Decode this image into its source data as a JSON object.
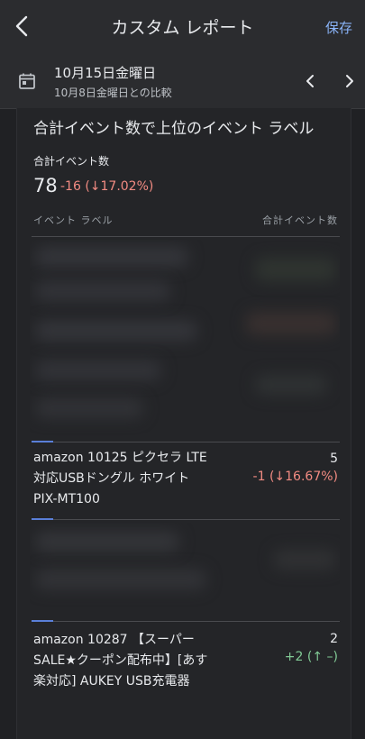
{
  "header": {
    "title": "カスタム レポート",
    "save_label": "保存"
  },
  "date": {
    "main": "10月15日金曜日",
    "comparison": "10月8日金曜日との比較"
  },
  "card": {
    "title": "合計イベント数で上位のイベント ラベル",
    "metric_label": "合計イベント数",
    "metric_value": "78",
    "metric_change": "-16 (↓17.02%)",
    "column_left": "イベント ラベル",
    "column_right": "合計イベント数"
  },
  "rows": [
    {
      "name": "amazon 10125 ピクセラ LTE対応USBドングル ホワイト PIX-MT100",
      "count": "5",
      "change": "-1 (↓16.67%)"
    },
    {
      "name": "amazon 10287 【スーパーSALE★クーポン配布中】[あす楽対応] AUKEY USB充電器",
      "count": "2",
      "change": "+2 (↑ –)"
    }
  ],
  "colors": {
    "accent": "#8ab4f8",
    "negative": "#f28b82",
    "positive": "#81c995",
    "bar_accent": "#5a7fd8"
  },
  "icons": {
    "back": "chevron-left-icon",
    "calendar": "calendar-icon",
    "prev": "chevron-left-icon",
    "next": "chevron-right-icon"
  }
}
